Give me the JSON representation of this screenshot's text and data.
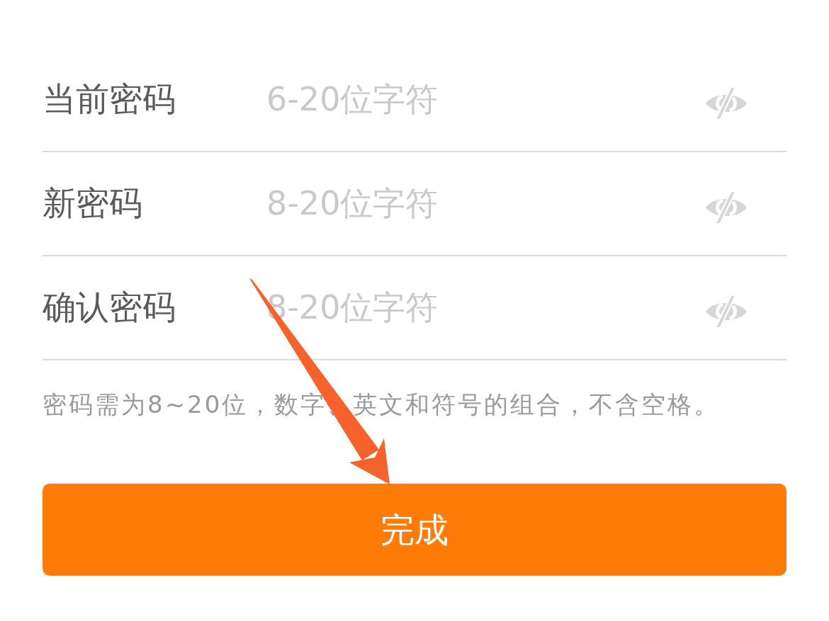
{
  "fields": [
    {
      "label": "当前密码",
      "placeholder": "6-20位字符",
      "show_password": false
    },
    {
      "label": "新密码",
      "placeholder": "8-20位字符",
      "show_password": false
    },
    {
      "label": "确认密码",
      "placeholder": "8-20位字符",
      "show_password": false
    }
  ],
  "hint": "密码需为8~20位，数字、英文和符号的组合，不含空格。",
  "submit_button": {
    "label": "完成"
  }
}
